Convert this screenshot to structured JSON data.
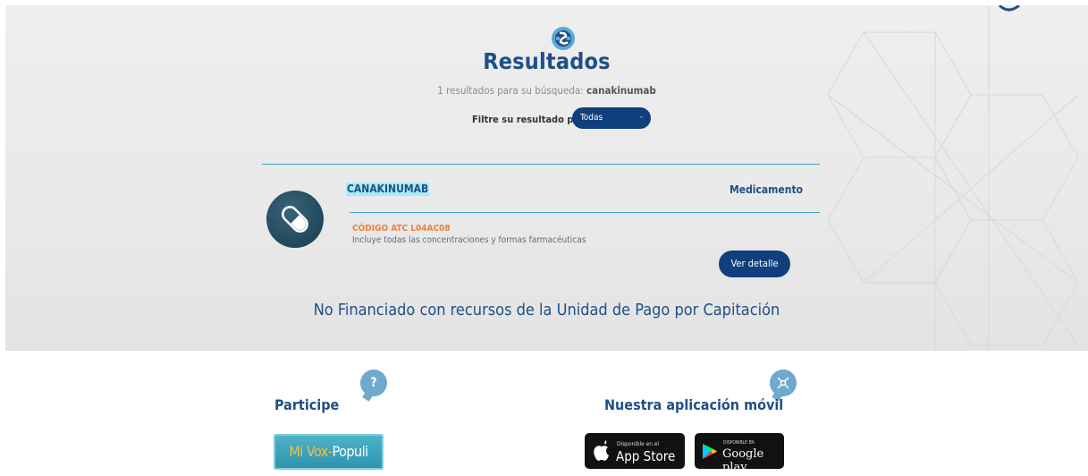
{
  "header": {
    "title": "Resultados",
    "subtitle_prefix": "1 resultados para su búsqueda:",
    "query": "canakinumab"
  },
  "filter": {
    "label": "Filtre su resultado por:",
    "selected": "Todas"
  },
  "result": {
    "name": "CANAKINUMAB",
    "type": "Medicamento",
    "atc": "CÓDIGO ATC L04AC08",
    "description": "Incluye todas las concentraciones y formas farmacéuticas",
    "detail_button": "Ver detalle",
    "icon": "pill-icon"
  },
  "funding_note": "No Financiado con recursos de la Unidad de Pago por Capitación",
  "footer": {
    "participate": {
      "title": "Participe",
      "icon": "question-icon",
      "vox_part1": "Mi Vox-",
      "vox_part2": "Populi"
    },
    "app": {
      "title": "Nuestra aplicación móvil",
      "icon": "app-icon",
      "appstore_small": "Disponible en el",
      "appstore_big": "App Store",
      "googleplay_small": "DISPONIBLE EN",
      "googleplay_big": "Google play"
    }
  },
  "colors": {
    "primary": "#1f4f86",
    "button": "#0f3f7c",
    "accent_line": "#3aa6c9",
    "atc_orange": "#f07f3c",
    "highlight": "#a7ecf3"
  }
}
